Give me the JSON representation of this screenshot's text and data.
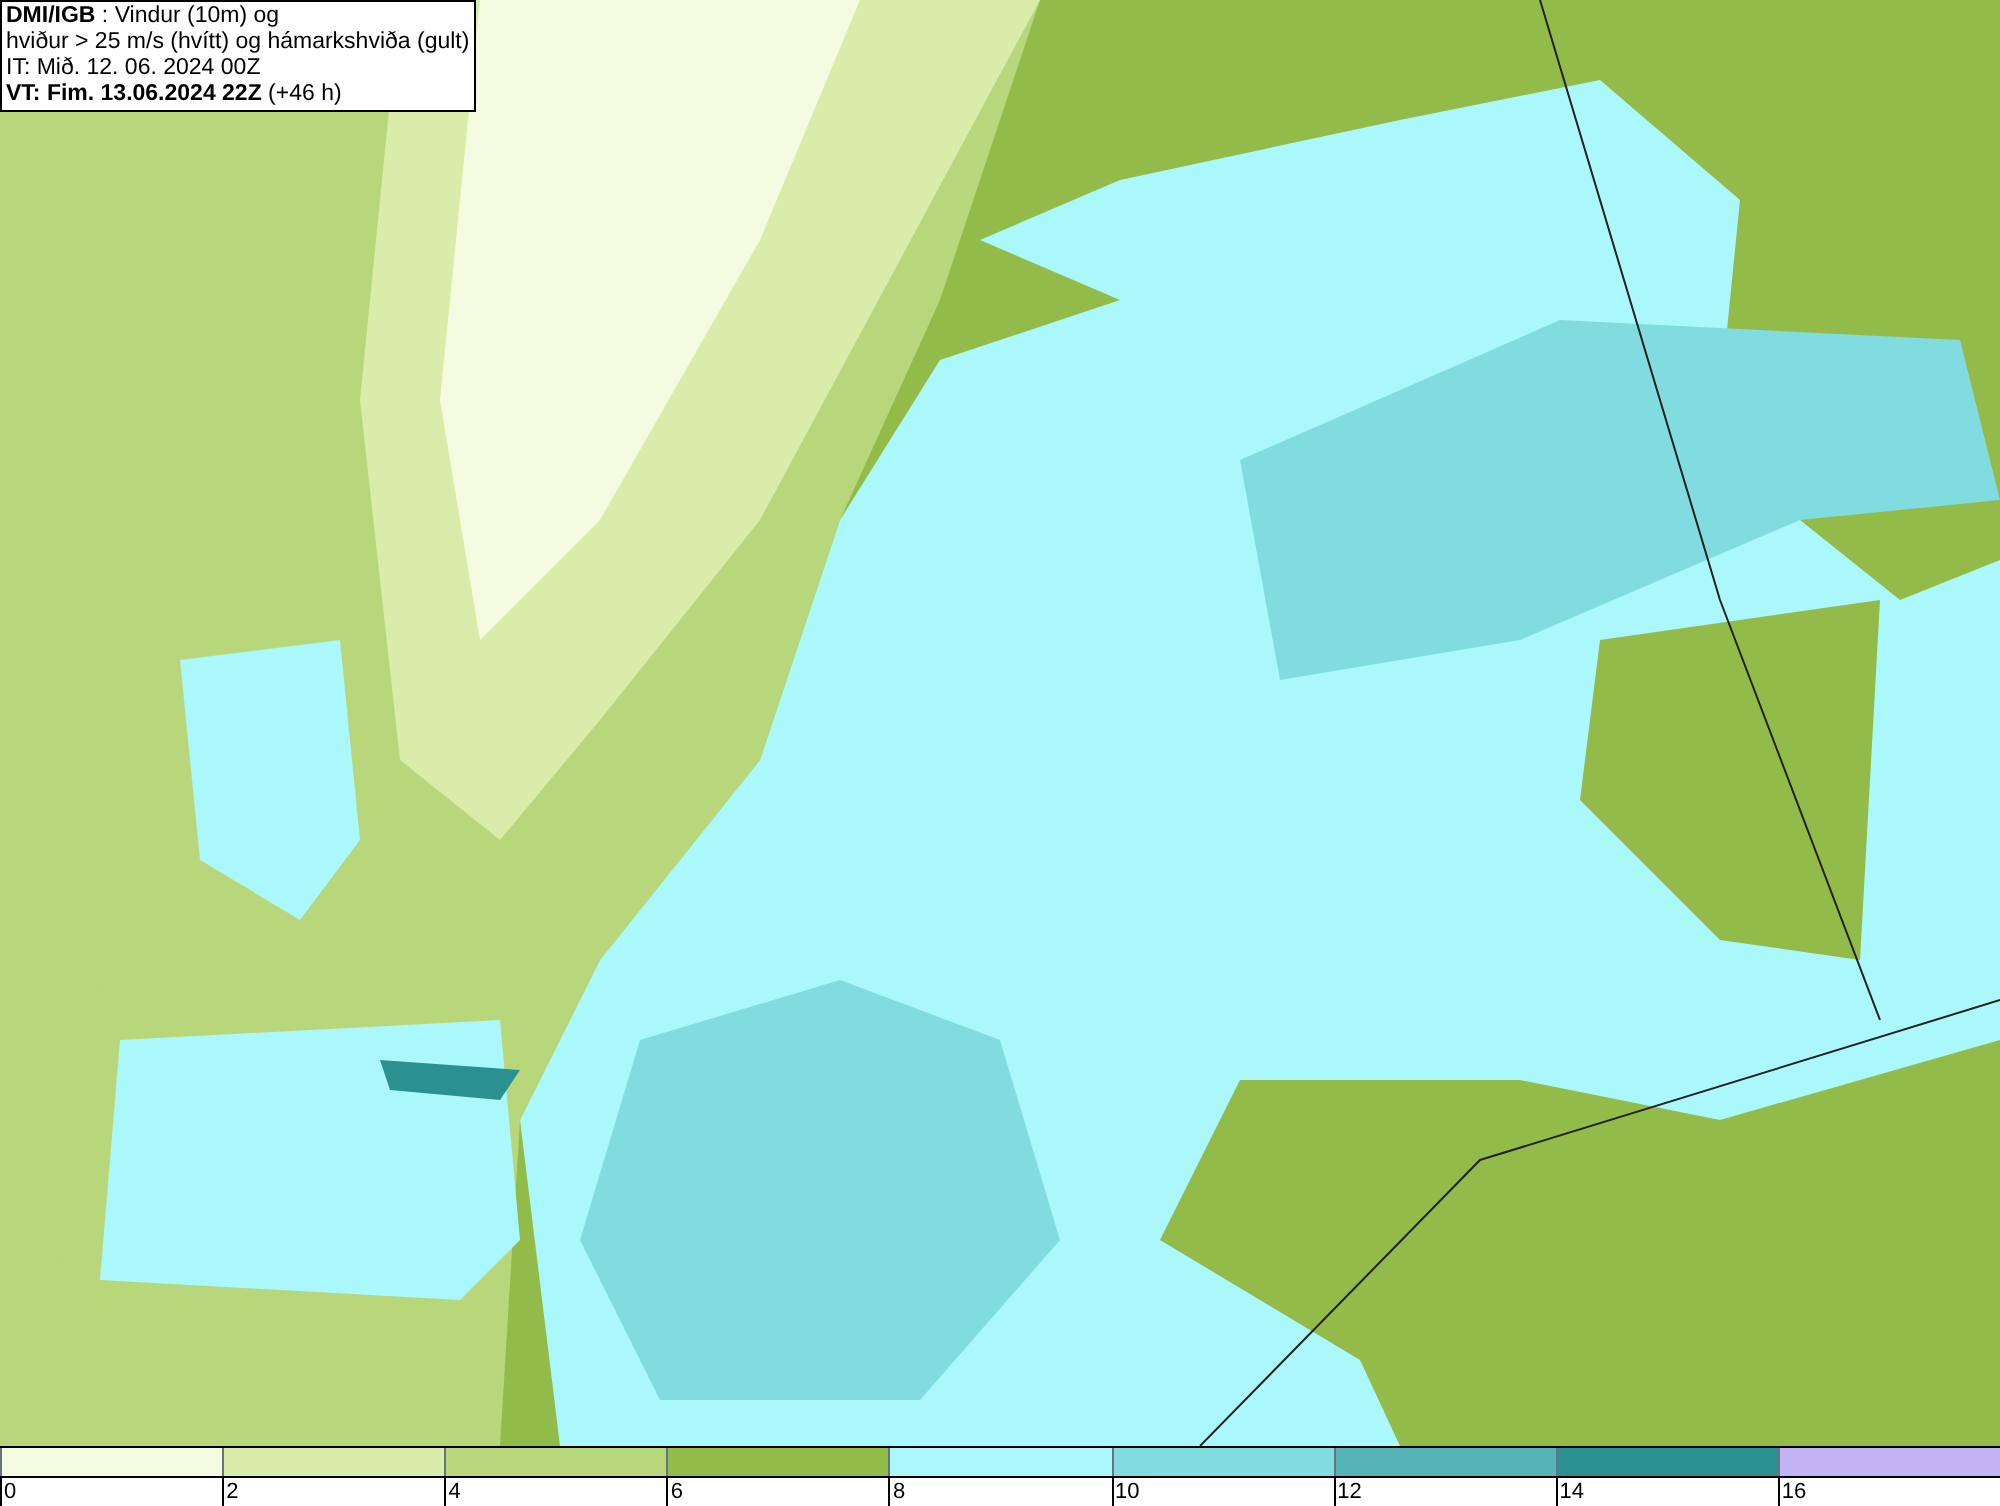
{
  "title_box": {
    "lines": [
      "**DMI/IGB** : Vindur (10m) og",
      "hviður > 25 m/s (hvítt) og hámarkshviða (gult)",
      "IT: Mið. 12. 06. 2024 00Z",
      "**VT: Fim. 13.06.2024 22Z** (+46 h)"
    ]
  },
  "legend": {
    "bins": [
      {
        "color": "#f5fbe0"
      },
      {
        "color": "#d9ecaa"
      },
      {
        "color": "#b7d77a"
      },
      {
        "color": "#93bb49"
      },
      {
        "color": "#aaf8fc"
      },
      {
        "color": "#80dcde"
      },
      {
        "color": "#55b5b6"
      },
      {
        "color": "#2a9090"
      },
      {
        "color": "#c3b4f5"
      }
    ],
    "ticks": [
      "0",
      "2",
      "4",
      "6",
      "8",
      "10",
      "12",
      "14",
      "16"
    ]
  }
}
